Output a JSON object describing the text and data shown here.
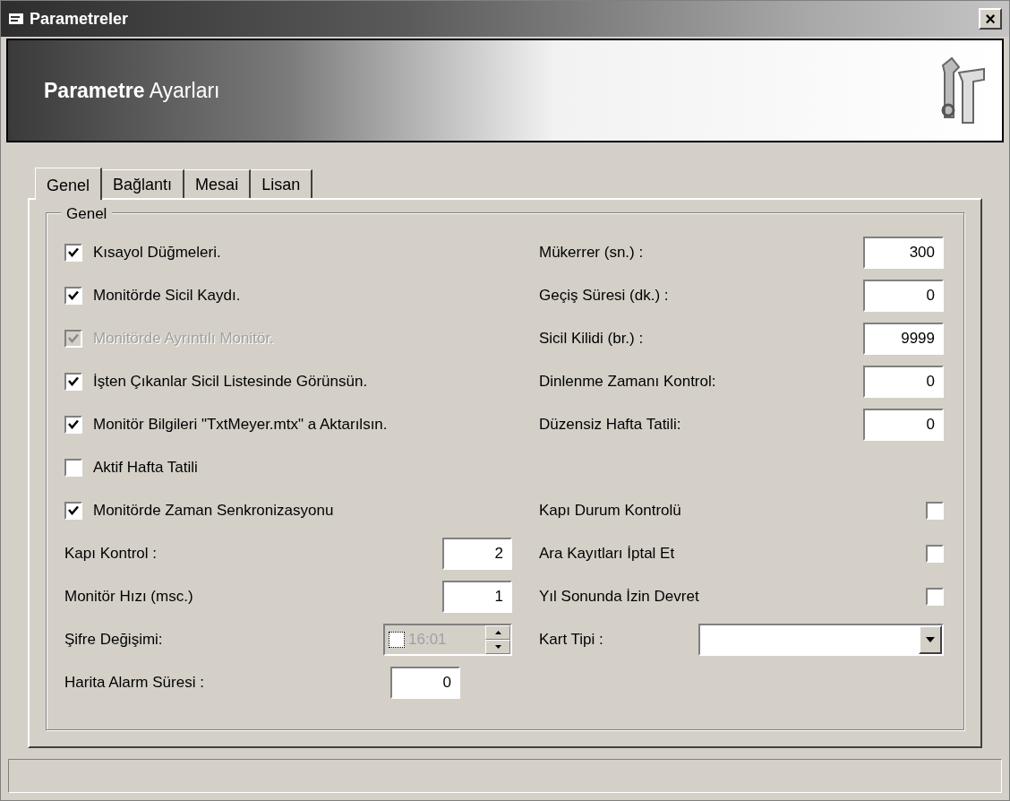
{
  "window": {
    "title": "Parametreler",
    "close": "×"
  },
  "banner": {
    "bold": "Parametre",
    "rest": "Ayarları"
  },
  "tabs": [
    {
      "label": "Genel",
      "selected": true
    },
    {
      "label": "Bağlantı",
      "selected": false
    },
    {
      "label": "Mesai",
      "selected": false
    },
    {
      "label": "Lisan",
      "selected": false
    }
  ],
  "group": {
    "title": "Genel",
    "left": [
      {
        "kind": "checkbox",
        "label": "Kısayol Düğmeleri.",
        "checked": true,
        "disabled": false
      },
      {
        "kind": "checkbox",
        "label": "Monitörde Sicil Kaydı.",
        "checked": true,
        "disabled": false
      },
      {
        "kind": "checkbox",
        "label": "Monitörde Ayrıntılı Monitör.",
        "checked": true,
        "disabled": true
      },
      {
        "kind": "checkbox",
        "label": "İşten Çıkanlar Sicil Listesinde Görünsün.",
        "checked": true,
        "disabled": false
      },
      {
        "kind": "checkbox",
        "label": "Monitör Bilgileri \"TxtMeyer.mtx\" a Aktarılsın.",
        "checked": true,
        "disabled": false
      },
      {
        "kind": "checkbox",
        "label": "Aktif Hafta Tatili",
        "checked": false,
        "disabled": false
      },
      {
        "kind": "checkbox",
        "label": "Monitörde Zaman Senkronizasyonu",
        "checked": true,
        "disabled": false
      },
      {
        "kind": "field",
        "label": "Kapı Kontrol :",
        "value": "2"
      },
      {
        "kind": "field",
        "label": "Monitör Hızı (msc.)",
        "value": "1"
      },
      {
        "kind": "time",
        "label": "Şifre Değişimi:",
        "value": "16:01",
        "checked": false
      },
      {
        "kind": "field",
        "label": "Harita Alarm Süresi :",
        "value": "0"
      }
    ],
    "right_fields": [
      {
        "label": "Mükerrer (sn.) :",
        "value": "300"
      },
      {
        "label": "Geçiş Süresi (dk.) :",
        "value": "0"
      },
      {
        "label": "Sicil Kilidi (br.) :",
        "value": "9999"
      },
      {
        "label": "Dinlenme Zamanı Kontrol:",
        "value": "0"
      },
      {
        "label": "Düzensiz Hafta Tatili:",
        "value": "0"
      }
    ],
    "right_options": [
      {
        "kind": "checkbox",
        "label": "Kapı Durum Kontrolü",
        "checked": false
      },
      {
        "kind": "checkbox",
        "label": "Ara Kayıtları İptal Et",
        "checked": false
      },
      {
        "kind": "checkbox",
        "label": "Yıl Sonunda İzin Devret",
        "checked": false
      },
      {
        "kind": "dropdown",
        "label": "Kart Tipi :"
      }
    ]
  }
}
